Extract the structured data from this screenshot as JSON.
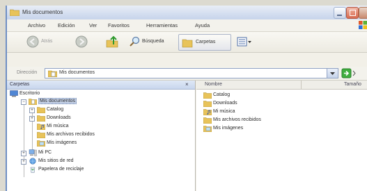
{
  "window": {
    "title": "Mis documentos"
  },
  "menu": [
    "Archivo",
    "Edición",
    "Ver",
    "Favoritos",
    "Herramientas",
    "Ayuda"
  ],
  "toolbar": {
    "back": "Atrás",
    "search": "Búsqueda",
    "folders": "Carpetas"
  },
  "address": {
    "label": "Dirección",
    "value": "Mis documentos"
  },
  "folders_pane": {
    "title": "Carpetas",
    "close_glyph": "×",
    "tree": [
      {
        "label": "Escritorio",
        "level": 0,
        "expander": "",
        "icon": "desktop"
      },
      {
        "label": "Mis documentos",
        "level": 1,
        "expander": "−",
        "icon": "folder-docs",
        "selected": true
      },
      {
        "label": "Catalog",
        "level": 2,
        "expander": "+",
        "icon": "folder"
      },
      {
        "label": "Downloads",
        "level": 2,
        "expander": "+",
        "icon": "folder"
      },
      {
        "label": "Mi música",
        "level": 2,
        "expander": "",
        "icon": "folder-music"
      },
      {
        "label": "Mis archivos recibidos",
        "level": 2,
        "expander": "",
        "icon": "folder"
      },
      {
        "label": "Mis imágenes",
        "level": 2,
        "expander": "",
        "icon": "folder-pictures"
      },
      {
        "label": "Mi PC",
        "level": 1,
        "expander": "+",
        "icon": "computer"
      },
      {
        "label": "Mis sitios de red",
        "level": 1,
        "expander": "+",
        "icon": "network"
      },
      {
        "label": "Papelera de reciclaje",
        "level": 1,
        "expander": "",
        "icon": "recycle-bin"
      }
    ]
  },
  "file_list": {
    "columns": {
      "name": "Nombre",
      "size": "Tamaño"
    },
    "items": [
      "Catalog",
      "Downloads",
      "Mi música",
      "Mis archivos recibidos",
      "Mis imágenes"
    ]
  }
}
